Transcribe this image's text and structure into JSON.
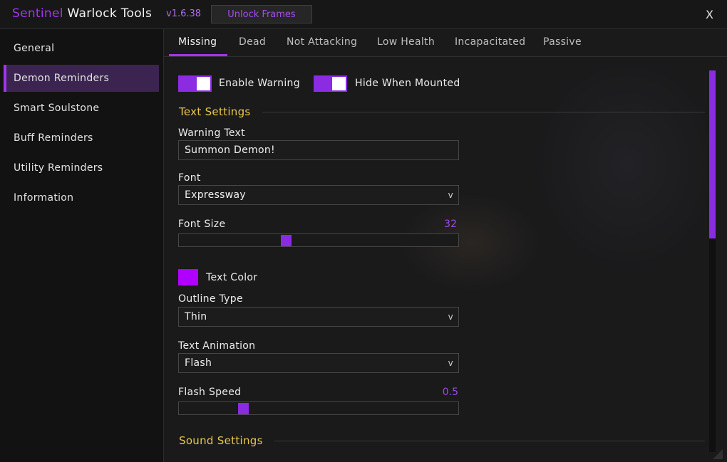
{
  "window": {
    "title_brand": "Sentinel",
    "title_rest": " Warlock Tools",
    "version": "v1.6.38",
    "unlock_label": "Unlock Frames",
    "close_label": "X",
    "accent_color": "#a335ee",
    "section_color": "#e8c84a"
  },
  "sidebar": {
    "items": [
      {
        "label": "General"
      },
      {
        "label": "Demon Reminders",
        "active": true
      },
      {
        "label": "Smart Soulstone"
      },
      {
        "label": "Buff Reminders"
      },
      {
        "label": "Utility Reminders"
      },
      {
        "label": "Information"
      }
    ]
  },
  "tabs": [
    {
      "label": "Missing",
      "active": true
    },
    {
      "label": "Dead"
    },
    {
      "label": "Not Attacking"
    },
    {
      "label": "Low Health"
    },
    {
      "label": "Incapacitated"
    },
    {
      "label": "Passive"
    }
  ],
  "toggles": {
    "enable_warning": {
      "label": "Enable Warning",
      "on": true
    },
    "hide_when_mounted": {
      "label": "Hide When Mounted",
      "on": true
    }
  },
  "text_settings": {
    "header": "Text Settings",
    "warning_text_label": "Warning Text",
    "warning_text_value": "Summon Demon!",
    "font_label": "Font",
    "font_value": "Expressway",
    "font_size_label": "Font Size",
    "font_size_value": "32",
    "font_size_fraction": 0.38,
    "text_color_label": "Text Color",
    "text_color_value": "#b000ff",
    "outline_label": "Outline Type",
    "outline_value": "Thin",
    "animation_label": "Text Animation",
    "animation_value": "Flash",
    "flash_speed_label": "Flash Speed",
    "flash_speed_value": "0.5",
    "flash_speed_fraction": 0.22,
    "dropdown_icon": "v"
  },
  "sound_settings": {
    "header": "Sound Settings"
  },
  "scroll": {
    "visible_fraction": 0.44
  }
}
